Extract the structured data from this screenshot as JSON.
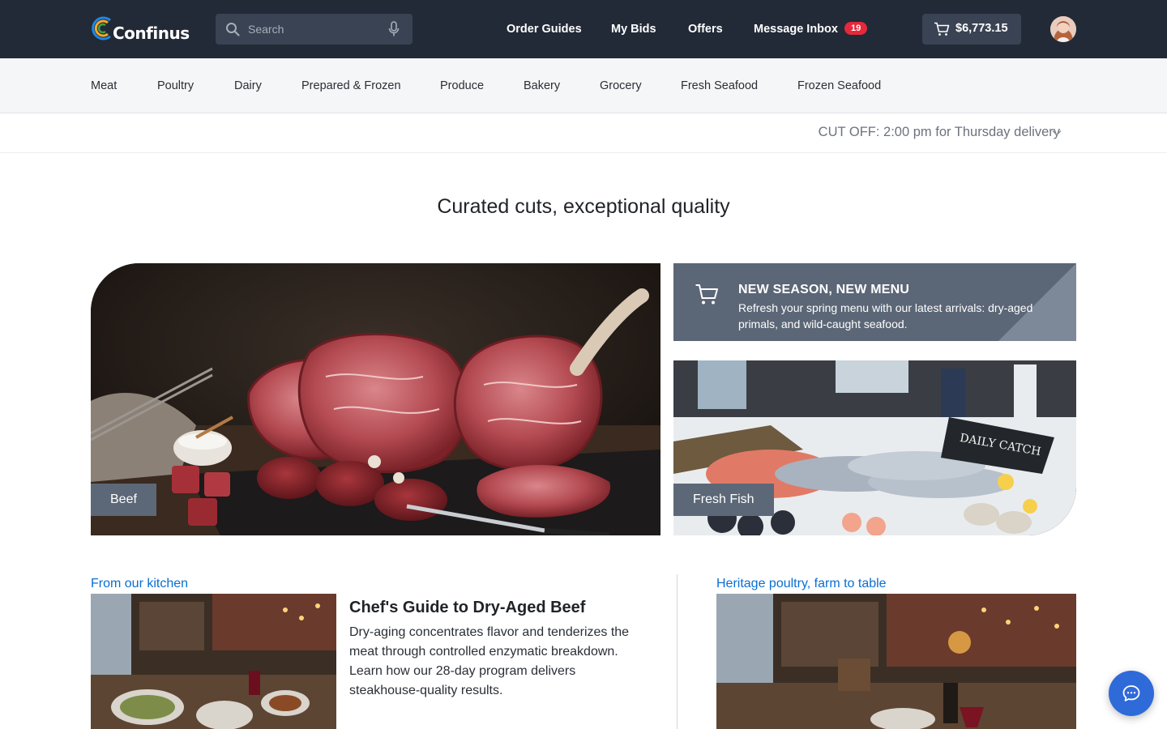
{
  "header": {
    "logo_text": "Confinus",
    "search_placeholder": "Search",
    "nav": [
      {
        "label": "Order Guides"
      },
      {
        "label": "My Bids"
      },
      {
        "label": "Offers"
      },
      {
        "label": "Message Inbox",
        "badge": "19"
      }
    ],
    "cart_total": "$6,773.15",
    "icons": {
      "search": "search-icon",
      "mic": "microphone-icon",
      "cart": "cart-icon",
      "avatar": "user-avatar"
    }
  },
  "categories": [
    "Meat",
    "Poultry",
    "Dairy",
    "Prepared & Frozen",
    "Produce",
    "Bakery",
    "Grocery",
    "Fresh Seafood",
    "Frozen Seafood"
  ],
  "cutoff": {
    "text": "CUT OFF: 2:00 pm for Thursday delivery"
  },
  "headline": "Curated cuts, exceptional quality",
  "tiles": {
    "beef": {
      "label": "Beef"
    },
    "fish": {
      "label": "Fresh Fish"
    }
  },
  "promo": {
    "title": "NEW SEASON, NEW MENU",
    "body": "Refresh your spring menu with our latest arrivals: dry-aged primals, and wild-caught seafood."
  },
  "kitchen": {
    "section_title": "From our kitchen",
    "article_title": "Chef's Guide to Dry-Aged Beef",
    "article_body": "Dry-aging concentrates flavor and tenderizes the meat through controlled enzymatic breakdown. Learn how our 28-day program delivers steakhouse-quality results."
  },
  "poultry": {
    "section_title": "Heritage poultry, farm to table"
  },
  "colors": {
    "topbar": "#222a37",
    "accent_link": "#0a6ed1",
    "badge": "#e5293b",
    "chat_button": "#2f6ad9",
    "tile_label": "#5c6878"
  }
}
